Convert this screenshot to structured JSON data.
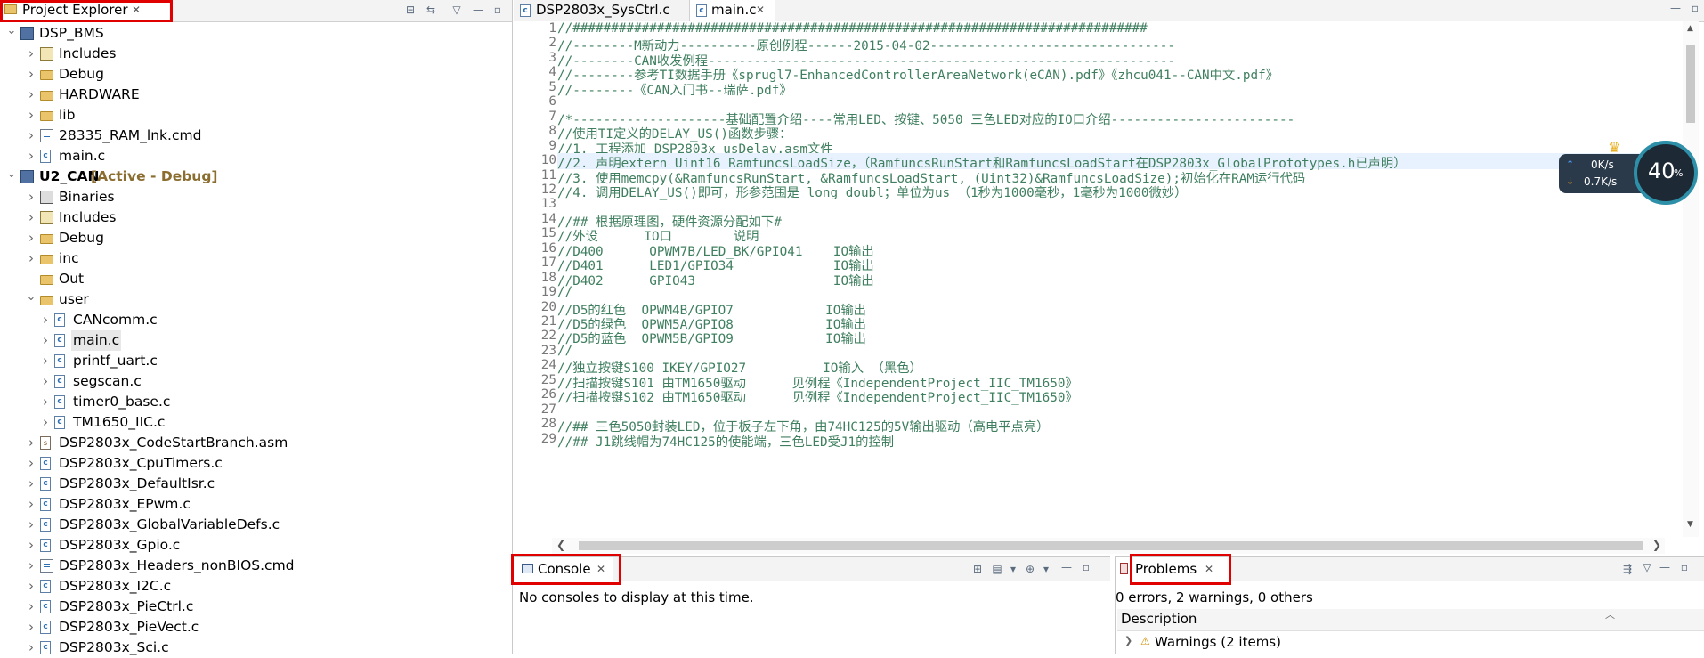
{
  "project_explorer": {
    "tab_label": "Project Explorer",
    "tree": [
      {
        "label": "DSP_BMS",
        "indent": 0,
        "expanded": true,
        "icon": "project-icon",
        "bold": false
      },
      {
        "label": "Includes",
        "indent": 1,
        "expanded": false,
        "icon": "includes-icon"
      },
      {
        "label": "Debug",
        "indent": 1,
        "expanded": false,
        "icon": "folder-icon"
      },
      {
        "label": "HARDWARE",
        "indent": 1,
        "expanded": false,
        "icon": "folder-icon"
      },
      {
        "label": "lib",
        "indent": 1,
        "expanded": false,
        "icon": "folder-icon"
      },
      {
        "label": "28335_RAM_lnk.cmd",
        "indent": 1,
        "expanded": false,
        "icon": "cmd-file-icon"
      },
      {
        "label": "main.c",
        "indent": 1,
        "expanded": false,
        "icon": "c-file-icon"
      },
      {
        "label": "U2_CAN",
        "tag": "[Active - Debug]",
        "indent": 0,
        "expanded": true,
        "icon": "project-icon",
        "bold": true
      },
      {
        "label": "Binaries",
        "indent": 1,
        "expanded": false,
        "icon": "binaries-icon"
      },
      {
        "label": "Includes",
        "indent": 1,
        "expanded": false,
        "icon": "includes-icon"
      },
      {
        "label": "Debug",
        "indent": 1,
        "expanded": false,
        "icon": "folder-icon"
      },
      {
        "label": "inc",
        "indent": 1,
        "expanded": false,
        "icon": "folder-icon"
      },
      {
        "label": "Out",
        "indent": 1,
        "expanded": null,
        "icon": "folder-icon"
      },
      {
        "label": "user",
        "indent": 1,
        "expanded": true,
        "icon": "folder-icon"
      },
      {
        "label": "CANcomm.c",
        "indent": 2,
        "expanded": false,
        "icon": "c-file-icon"
      },
      {
        "label": "main.c",
        "indent": 2,
        "expanded": false,
        "icon": "c-file-icon",
        "selected": true
      },
      {
        "label": "printf_uart.c",
        "indent": 2,
        "expanded": false,
        "icon": "c-file-icon"
      },
      {
        "label": "segscan.c",
        "indent": 2,
        "expanded": false,
        "icon": "c-file-icon"
      },
      {
        "label": "timer0_base.c",
        "indent": 2,
        "expanded": false,
        "icon": "c-file-icon"
      },
      {
        "label": "TM1650_IIC.c",
        "indent": 2,
        "expanded": false,
        "icon": "c-file-icon"
      },
      {
        "label": "DSP2803x_CodeStartBranch.asm",
        "indent": 1,
        "expanded": false,
        "icon": "asm-file-icon"
      },
      {
        "label": "DSP2803x_CpuTimers.c",
        "indent": 1,
        "expanded": false,
        "icon": "c-file-icon"
      },
      {
        "label": "DSP2803x_DefaultIsr.c",
        "indent": 1,
        "expanded": false,
        "icon": "c-file-icon"
      },
      {
        "label": "DSP2803x_EPwm.c",
        "indent": 1,
        "expanded": false,
        "icon": "c-file-icon"
      },
      {
        "label": "DSP2803x_GlobalVariableDefs.c",
        "indent": 1,
        "expanded": false,
        "icon": "c-file-icon"
      },
      {
        "label": "DSP2803x_Gpio.c",
        "indent": 1,
        "expanded": false,
        "icon": "c-file-icon"
      },
      {
        "label": "DSP2803x_Headers_nonBIOS.cmd",
        "indent": 1,
        "expanded": false,
        "icon": "cmd-file-icon"
      },
      {
        "label": "DSP2803x_I2C.c",
        "indent": 1,
        "expanded": false,
        "icon": "c-file-icon"
      },
      {
        "label": "DSP2803x_PieCtrl.c",
        "indent": 1,
        "expanded": false,
        "icon": "c-file-icon"
      },
      {
        "label": "DSP2803x_PieVect.c",
        "indent": 1,
        "expanded": false,
        "icon": "c-file-icon"
      },
      {
        "label": "DSP2803x_Sci.c",
        "indent": 1,
        "expanded": false,
        "icon": "c-file-icon"
      }
    ]
  },
  "editor": {
    "tabs": [
      {
        "label": "DSP2803x_SysCtrl.c",
        "active": false
      },
      {
        "label": "main.c",
        "active": true
      }
    ],
    "lines": [
      "//###########################################################################",
      "//--------M新动力----------原创例程------2015-04-02--------------------------------",
      "//--------CAN收发例程-------------------------------------------------------------",
      "//--------参考TI数据手册《sprugl7-EnhancedControllerAreaNetwork(eCAN).pdf》《zhcu041--CAN中文.pdf》",
      "//--------《CAN入门书--瑞萨.pdf》",
      "",
      "/*--------------------基础配置介绍----常用LED、按键、5050 三色LED对应的IO口介绍------------------------",
      "//使用TI定义的DELAY_US()函数步骤：",
      "//1. 工程添加 DSP2803x_usDelay.asm文件",
      "//2. 声明extern Uint16 RamfuncsLoadSize，（RamfuncsRunStart和RamfuncsLoadStart在DSP2803x_GlobalPrototypes.h已声明）",
      "//3. 使用memcpy(&RamfuncsRunStart, &RamfuncsLoadStart, (Uint32)&RamfuncsLoadSize);初始化在RAM运行代码",
      "//4. 调用DELAY_US()即可，形参范围是 long doubl；单位为us （1秒为1000毫秒，1毫秒为1000微妙）",
      "",
      "//## 根据原理图，硬件资源分配如下#",
      "//外设      IO口        说明",
      "//D400      OPWM7B/LED_BK/GPIO41    IO输出",
      "//D401      LED1/GPIO34             IO输出",
      "//D402      GPIO43                  IO输出",
      "//",
      "//D5的红色  OPWM4B/GPIO7            IO输出",
      "//D5的绿色  OPWM5A/GPIO8            IO输出",
      "//D5的蓝色  OPWM5B/GPIO9            IO输出",
      "//",
      "//独立按键S100 IKEY/GPIO27          IO输入 （黑色）",
      "//扫描按键S101 由TM1650驱动      见例程《IndependentProject_IIC_TM1650》",
      "//扫描按键S102 由TM1650驱动      见例程《IndependentProject_IIC_TM1650》",
      "",
      "//## 三色5050封装LED，位于板子左下角，由74HC125的5V输出驱动（高电平点亮）",
      "//## J1跳线帽为74HC125的使能端，三色LED受J1的控制"
    ],
    "highlighted_line": 10
  },
  "network_widget": {
    "upload": "0K/s",
    "download": "0.7K/s",
    "percent": "40",
    "percent_sign": "%"
  },
  "console": {
    "tab_label": "Console",
    "message": "No consoles to display at this time."
  },
  "problems": {
    "tab_label": "Problems",
    "summary": "0 errors, 2 warnings, 0 others",
    "column_header": "Description",
    "warnings_row": "Warnings (2 items)"
  },
  "colors": {
    "comment_green": "#3f7f5f",
    "active_tag": "#8a6d2f",
    "highlight_red": "#e00000"
  }
}
